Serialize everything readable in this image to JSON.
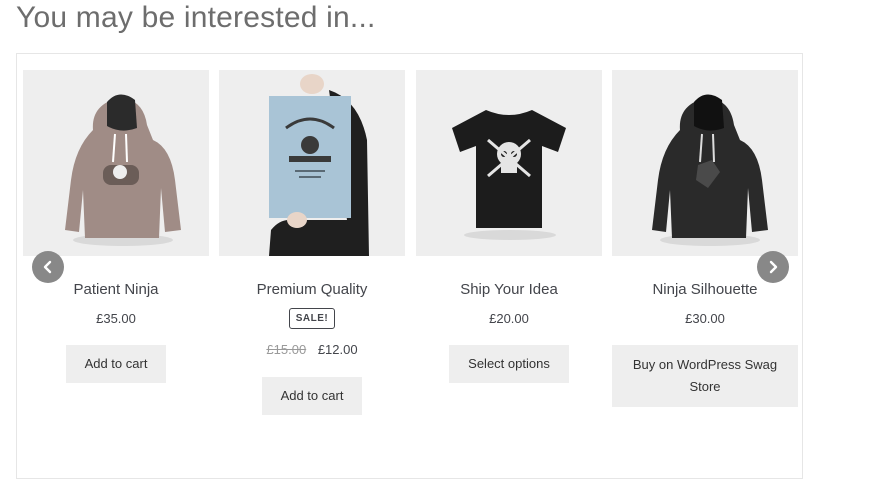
{
  "section": {
    "heading": "You may be interested in..."
  },
  "products": [
    {
      "title": "Patient Ninja",
      "price": "£35.00",
      "button": "Add to cart",
      "image": "hoodie-grey"
    },
    {
      "title": "Premium Quality",
      "badge": "SALE!",
      "old_price": "£15.00",
      "price": "£12.00",
      "button": "Add to cart",
      "image": "poster"
    },
    {
      "title": "Ship Your Idea",
      "price": "£20.00",
      "button": "Select options",
      "image": "tshirt-black"
    },
    {
      "title": "Ninja Silhouette",
      "price": "£30.00",
      "button": "Buy on WordPress Swag Store",
      "image": "hoodie-black"
    }
  ],
  "carousel": {
    "prev_icon": "chevron-left-icon",
    "next_icon": "chevron-right-icon"
  },
  "colors": {
    "thumb_bg": "#eeeeee",
    "button_bg": "#eeeeee",
    "nav_bg": "#888888",
    "text": "#43454b"
  }
}
